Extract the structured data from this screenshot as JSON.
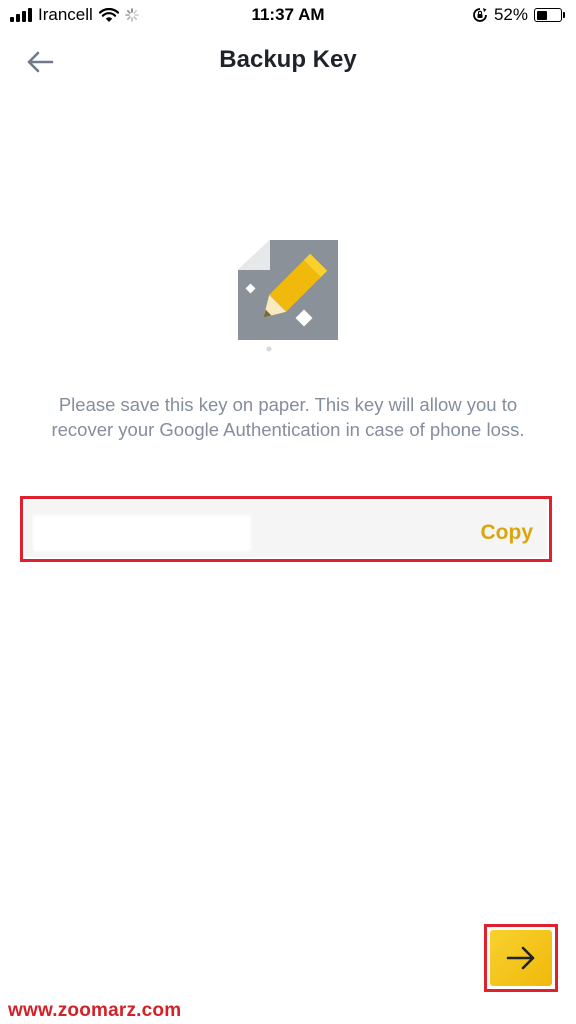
{
  "status_bar": {
    "carrier": "Irancell",
    "time": "11:37 AM",
    "battery_text": "52%",
    "battery_level": 0.52,
    "icons": [
      "signal-icon",
      "wifi-icon",
      "loading-icon",
      "orientation-lock-icon",
      "battery-icon"
    ]
  },
  "header": {
    "title": "Backup Key",
    "back_icon": "arrow-left-icon"
  },
  "illustration": {
    "icon": "paper-pencil-icon"
  },
  "description": {
    "text": "Please save this key on paper. This key will allow you to recover your Google Authentication in case of phone loss."
  },
  "key_field": {
    "value": "",
    "copy_label": "Copy"
  },
  "next_button": {
    "icon": "arrow-right-icon"
  },
  "watermark": {
    "text": "www.zoomarz.com"
  },
  "colors": {
    "accent": "#f0b90b",
    "copy_text": "#d9a60f",
    "highlight_border": "#e0202c",
    "title_text": "#1e2329",
    "muted_text": "#848e9c",
    "field_bg": "#f5f5f5",
    "watermark": "#d42128"
  }
}
